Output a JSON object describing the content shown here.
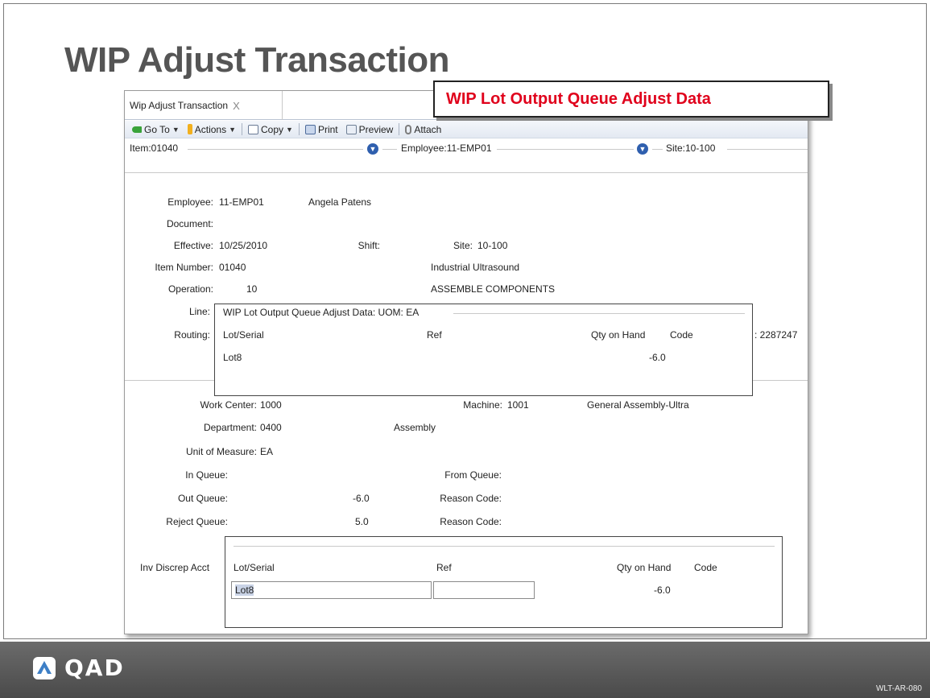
{
  "slide": {
    "title": "WIP Adjust Transaction",
    "callout": "WIP Lot Output Queue Adjust Data",
    "logo_text": "QAD",
    "slide_id": "WLT-AR-080"
  },
  "tab": {
    "label": "Wip Adjust Transaction",
    "close": "X"
  },
  "toolbar": {
    "goto": "Go To",
    "actions": "Actions",
    "copy": "Copy",
    "print": "Print",
    "preview": "Preview",
    "attach": "Attach"
  },
  "header": {
    "item": "Item:01040",
    "employee": "Employee:11-EMP01",
    "site": "Site:10-100"
  },
  "form": {
    "employee_label": "Employee:",
    "employee_value": "11-EMP01",
    "employee_name": "Angela Patens",
    "document_label": "Document:",
    "effective_label": "Effective:",
    "effective_value": "10/25/2010",
    "shift_label": "Shift:",
    "site_label": "Site:",
    "site_value": "10-100",
    "item_number_label": "Item Number:",
    "item_number_value": "01040",
    "item_desc": "Industrial Ultrasound",
    "operation_label": "Operation:",
    "operation_value": "10",
    "operation_desc": "ASSEMBLE COMPONENTS",
    "line_label": "Line:",
    "routing_label": "Routing:",
    "routing_suffix": ": 2287247",
    "work_center_label": "Work Center:",
    "work_center_value": "1000",
    "machine_label": "Machine:",
    "machine_value": "1001",
    "machine_desc": "General Assembly-Ultra",
    "department_label": "Department:",
    "department_value": "0400",
    "department_desc": "Assembly",
    "uom_label": "Unit of Measure:",
    "uom_value": "EA",
    "in_queue_label": "In Queue:",
    "from_queue_label": "From Queue:",
    "out_queue_label": "Out Queue:",
    "out_queue_value": "-6.0",
    "reason_code_label": "Reason Code:",
    "reject_queue_label": "Reject Queue:",
    "reject_queue_value": "5.0",
    "reason_code_label2": "Reason Code:",
    "inv_discrep_label": "Inv Discrep Acct"
  },
  "panel1": {
    "title": "WIP Lot Output Queue Adjust Data:  UOM: EA",
    "col_lot": "Lot/Serial",
    "col_ref": "Ref",
    "col_qty": "Qty on Hand",
    "col_code": "Code",
    "row_lot": "Lot8",
    "row_qty": "-6.0"
  },
  "panel2": {
    "col_lot": "Lot/Serial",
    "col_ref": "Ref",
    "col_qty": "Qty on Hand",
    "col_code": "Code",
    "lot_value": "Lot8",
    "ref_value": "",
    "row_qty": "-6.0"
  }
}
